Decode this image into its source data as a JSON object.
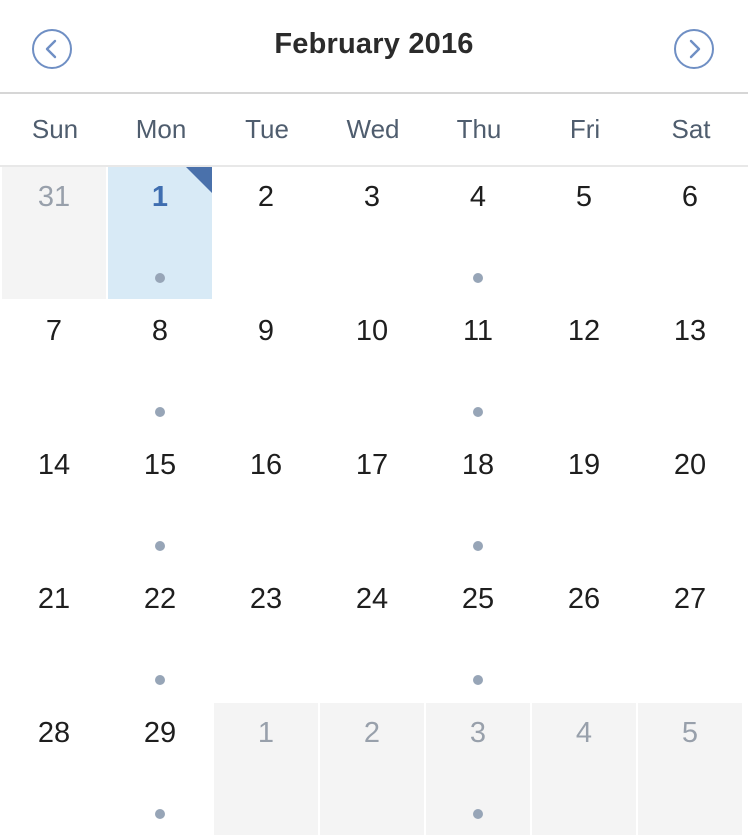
{
  "header": {
    "month_title": "February 2016",
    "prev_icon": "chevron-left-icon",
    "next_icon": "chevron-right-icon"
  },
  "colors": {
    "accent": "#4a71ab",
    "selected_bg": "#d8eaf6",
    "other_month_bg": "#f4f4f4",
    "event_dot": "#97a5b7"
  },
  "weekdays": [
    "Sun",
    "Mon",
    "Tue",
    "Wed",
    "Thu",
    "Fri",
    "Sat"
  ],
  "weeks": [
    [
      {
        "day": "31",
        "other": true,
        "dot": false,
        "selected": false
      },
      {
        "day": "1",
        "other": false,
        "dot": true,
        "selected": true
      },
      {
        "day": "2",
        "other": false,
        "dot": false,
        "selected": false
      },
      {
        "day": "3",
        "other": false,
        "dot": false,
        "selected": false
      },
      {
        "day": "4",
        "other": false,
        "dot": true,
        "selected": false
      },
      {
        "day": "5",
        "other": false,
        "dot": false,
        "selected": false
      },
      {
        "day": "6",
        "other": false,
        "dot": false,
        "selected": false
      }
    ],
    [
      {
        "day": "7",
        "other": false,
        "dot": false,
        "selected": false
      },
      {
        "day": "8",
        "other": false,
        "dot": true,
        "selected": false
      },
      {
        "day": "9",
        "other": false,
        "dot": false,
        "selected": false
      },
      {
        "day": "10",
        "other": false,
        "dot": false,
        "selected": false
      },
      {
        "day": "11",
        "other": false,
        "dot": true,
        "selected": false
      },
      {
        "day": "12",
        "other": false,
        "dot": false,
        "selected": false
      },
      {
        "day": "13",
        "other": false,
        "dot": false,
        "selected": false
      }
    ],
    [
      {
        "day": "14",
        "other": false,
        "dot": false,
        "selected": false
      },
      {
        "day": "15",
        "other": false,
        "dot": true,
        "selected": false
      },
      {
        "day": "16",
        "other": false,
        "dot": false,
        "selected": false
      },
      {
        "day": "17",
        "other": false,
        "dot": false,
        "selected": false
      },
      {
        "day": "18",
        "other": false,
        "dot": true,
        "selected": false
      },
      {
        "day": "19",
        "other": false,
        "dot": false,
        "selected": false
      },
      {
        "day": "20",
        "other": false,
        "dot": false,
        "selected": false
      }
    ],
    [
      {
        "day": "21",
        "other": false,
        "dot": false,
        "selected": false
      },
      {
        "day": "22",
        "other": false,
        "dot": true,
        "selected": false
      },
      {
        "day": "23",
        "other": false,
        "dot": false,
        "selected": false
      },
      {
        "day": "24",
        "other": false,
        "dot": false,
        "selected": false
      },
      {
        "day": "25",
        "other": false,
        "dot": true,
        "selected": false
      },
      {
        "day": "26",
        "other": false,
        "dot": false,
        "selected": false
      },
      {
        "day": "27",
        "other": false,
        "dot": false,
        "selected": false
      }
    ],
    [
      {
        "day": "28",
        "other": false,
        "dot": false,
        "selected": false
      },
      {
        "day": "29",
        "other": false,
        "dot": true,
        "selected": false
      },
      {
        "day": "1",
        "other": true,
        "dot": false,
        "selected": false
      },
      {
        "day": "2",
        "other": true,
        "dot": false,
        "selected": false
      },
      {
        "day": "3",
        "other": true,
        "dot": true,
        "selected": false
      },
      {
        "day": "4",
        "other": true,
        "dot": false,
        "selected": false
      },
      {
        "day": "5",
        "other": true,
        "dot": false,
        "selected": false
      }
    ]
  ]
}
